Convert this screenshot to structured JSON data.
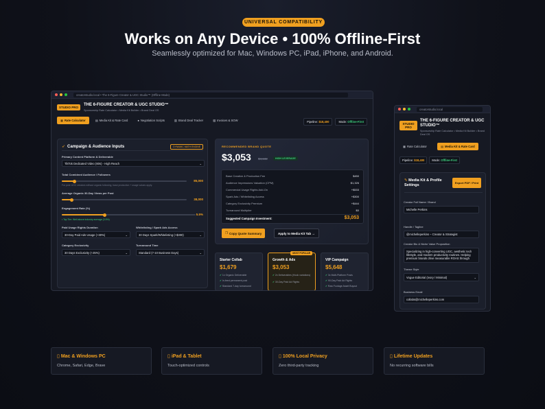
{
  "hero": {
    "badge": "UNIVERSAL COMPATIBILITY",
    "title": "Works on Any Device • 100% Offline-First",
    "subtitle": "Seamlessly optimized for Mac, Windows PC, iPad, iPhone, and Android."
  },
  "desktop": {
    "url": "creatorstudio.local • The 6-Figure Creator & UGC Studio™ (Offline Mode)",
    "badge": "STUDIO PRO",
    "app_title": "THE 6-FIGURE CREATOR & UGC STUDIO™",
    "app_sub": "Sponsorship Rate Calculator • Media Kit Builder • Brand Deal OS",
    "tabs": [
      "Rate Calculator",
      "Media Kit & Rate Card",
      "Negotiation Scripts",
      "Brand Deal Tracker",
      "Invoices & SOW"
    ],
    "pipeline_label": "Pipeline:",
    "pipeline_value": "$18,400",
    "mode_label": "Mode:",
    "mode_value": "Offline-First",
    "inputs": {
      "heading": "Campaign & Audience Inputs",
      "engine_badge": "DYNAMIC MATH ENGINE",
      "platform_label": "Primary Content Platform & Deliverable",
      "platform_value": "TikTok Dedicated Video (60s) - High Reach",
      "audience_label": "Total Combined Audience / Followers",
      "audience_value": "85,000",
      "audience_level": 0.1,
      "audience_hint": "For pure UGC creators without organic following, base production + usage values apply.",
      "views_label": "Average Organic 30-Day Views per Post",
      "views_value": "38,000",
      "views_level": 0.08,
      "engagement_label": "Engagement Rate (%)",
      "engagement_value": "5.5%",
      "engagement_level": 0.32,
      "engagement_hint": "• Top Tier: Well above industry average (3.5%)",
      "usage_label": "Paid Usage Rights Duration",
      "usage_value": "30-Day Paid Ads Usage (+30%)",
      "whitelist_label": "Whitelisting / Spark Ads Access",
      "whitelist_value": "30 Days Spark/Whitelisting (+$300)",
      "exclusivity_label": "Category Exclusivity",
      "exclusivity_value": "30 Days Exclusivity (+25%)",
      "turnaround_label": "Turnaround Time",
      "turnaround_value": "Standard (7-10 Business Days)"
    },
    "quote": {
      "heading": "RECOMMENDED BRAND QUOTE",
      "amount": "$3,053",
      "old_amount": "$4,132",
      "leverage": "HIGH LEVERAGE",
      "rows": [
        {
          "label": "Base Creative & Production Fee",
          "value": "$450"
        },
        {
          "label": "Audience Impressions Valuation (CPM)",
          "value": "$1,326"
        },
        {
          "label": "Commercial Usage Rights Add-On",
          "value": "+$533"
        },
        {
          "label": "Spark Ads / Whitelisting Access",
          "value": "+$300"
        },
        {
          "label": "Category Exclusivity Premium",
          "value": "+$444"
        },
        {
          "label": "Turnaround Multiplier",
          "value": "$0"
        }
      ],
      "total_label": "Suggested Campaign Investment:",
      "total_value": "$3,053",
      "copy_button": "Copy Quote Summary",
      "apply_button": "Apply to Media Kit Tab →"
    },
    "tiers": [
      {
        "name": "Starter Collab",
        "price": "$1,679",
        "items": [
          "1x Organic Deliverable",
          "In-feed permanent post",
          "Standard 7-day turnaround"
        ]
      },
      {
        "name": "Growth & Ads",
        "price": "$3,053",
        "badge": "MOST POPULAR",
        "items": [
          "2x Deliverables (Hook variations)",
          "30-Day Paid Ad Rights"
        ]
      },
      {
        "name": "VIP Campaign",
        "price": "$5,648",
        "items": [
          "3x Multi-Platform Posts",
          "90-Day Paid Ad Rights",
          "Raw Footage Asset Buyout"
        ]
      }
    ]
  },
  "mobile": {
    "url": "creatorstudio.local",
    "badge": "STUDIO PRO",
    "app_title": "THE 6-FIGURE CREATOR & UGC STUDIO™",
    "app_sub": "Sponsorship Rate Calculator • Media Kit Builder • Brand Deal OS",
    "tab1": "Rate Calculator",
    "tab2": "Media Kit & Rate Card",
    "pipeline_label": "Pipeline:",
    "pipeline_value": "$18,400",
    "mode_label": "Mode:",
    "mode_value": "Offline-First",
    "heading": "Media Kit & Profile Settings",
    "export_button": "Export PDF / Print",
    "name_label": "Creator Full Name / Brand",
    "name_value": "Michelle Perkins",
    "handle_label": "Handle / Tagline",
    "handle_value": "@michelleperkins – Creator & Strategist",
    "bio_label": "Creator Bio & Niche Value Proposition",
    "bio_value": "Specializing in high-converting UGC, aesthetic tech lifestyle, and modern productivity routines. Helping premium brands drive measurable ROAS through",
    "theme_label": "Theme Style",
    "theme_value": "Vogue Editorial (Ivory / Minimal)",
    "email_label": "Business Email",
    "email_value": "collabs@michelleperkins.com"
  },
  "features": [
    {
      "title": "Mac & Windows PC",
      "desc": "Chrome, Safari, Edge, Brave"
    },
    {
      "title": "iPad & Tablet",
      "desc": "Touch-optimized controls"
    },
    {
      "title": "100% Local Privacy",
      "desc": "Zero third-party tracking"
    },
    {
      "title": "Lifetime Updates",
      "desc": "No recurring software bills"
    }
  ],
  "colors": {
    "accent": "#f0a020",
    "success": "#3ccf7d",
    "background": "#0f1119"
  }
}
